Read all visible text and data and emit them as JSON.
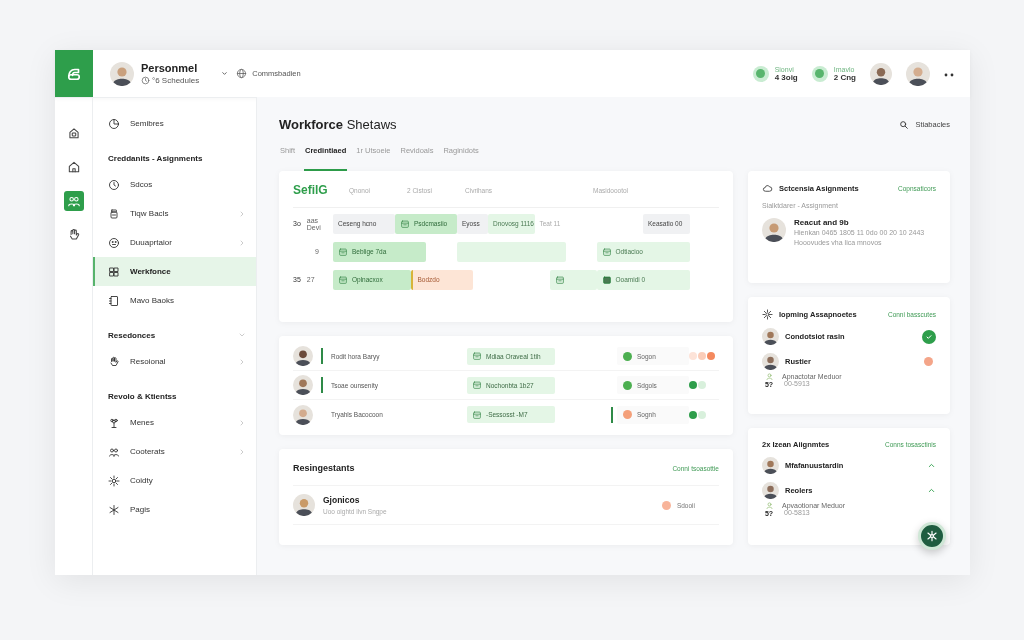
{
  "header": {
    "title": "Personmel",
    "subtitle": "°6 Schedules",
    "location": "Commsbadien",
    "stats": [
      {
        "label": "Sionvi",
        "value": "4 3oig"
      },
      {
        "label": "Imavlo",
        "value": "2 Cng"
      }
    ]
  },
  "rail": [
    {
      "selected": false
    },
    {
      "selected": false
    },
    {
      "selected": true
    },
    {
      "selected": false
    }
  ],
  "sidebar": {
    "items": [
      {
        "kind": "item",
        "label": "Semibres",
        "chevron": false,
        "selected": false
      },
      {
        "kind": "section",
        "label": "Creddanits - Asignments",
        "collapsible": false
      },
      {
        "kind": "item",
        "label": "Sdcos",
        "chevron": false,
        "selected": false
      },
      {
        "kind": "item",
        "label": "Tiqw Bacls",
        "chevron": true,
        "selected": false
      },
      {
        "kind": "item",
        "label": "Duuaprtaior",
        "chevron": true,
        "selected": false
      },
      {
        "kind": "item",
        "label": "Werkfonce",
        "chevron": false,
        "selected": true
      },
      {
        "kind": "item",
        "label": "Mavo Baoks",
        "chevron": false,
        "selected": false
      },
      {
        "kind": "section",
        "label": "Resedonces",
        "collapsible": true
      },
      {
        "kind": "item",
        "label": "Resoional",
        "chevron": true,
        "selected": false
      },
      {
        "kind": "section",
        "label": "Revolo & Ktientss",
        "collapsible": false
      },
      {
        "kind": "item",
        "label": "Menes",
        "chevron": true,
        "selected": false
      },
      {
        "kind": "item",
        "label": "Cooterats",
        "chevron": true,
        "selected": false
      },
      {
        "kind": "item",
        "label": "Coidty",
        "chevron": false,
        "selected": false
      },
      {
        "kind": "item",
        "label": "Pagis",
        "chevron": false,
        "selected": false
      }
    ]
  },
  "page": {
    "title": "**Workforce** Shetaws",
    "search": "Stiabacles",
    "tabs": [
      {
        "label": "Shift",
        "selected": false
      },
      {
        "label": "Credintiaed",
        "selected": true
      },
      {
        "label": "1r Utsoeie",
        "selected": false
      },
      {
        "label": "Revidoals",
        "selected": false
      },
      {
        "label": "Raginidots",
        "selected": false
      }
    ]
  },
  "schedule": {
    "title": "SefilG",
    "columns": [
      "Qnonoi",
      "2 Cistosi",
      "Civrihans",
      "Masidoootol"
    ],
    "rows": [
      {
        "label": "3o",
        "sublabel": "aas Devi",
        "cells": [
          {
            "kind": "plain",
            "text": "Ceseng hcno"
          },
          {
            "kind": "shift",
            "text": "Psdcmasiio"
          },
          {
            "kind": "plain",
            "text": "Eyoss"
          },
          {
            "kind": "note",
            "text": "Dnovosg 1116"
          },
          {
            "kind": "faint",
            "text": "Teat 11"
          },
          {
            "kind": "plain",
            "text": "Keasatio 00"
          }
        ]
      },
      {
        "sublabel": "9",
        "cells": [
          {
            "kind": "shift",
            "text": "Beblige 7da"
          },
          {
            "kind": "blank"
          },
          {
            "kind": "event",
            "text": "Odtiacioo"
          }
        ]
      },
      {
        "label": "35",
        "sublabel": "27",
        "cells": [
          {
            "kind": "shift",
            "text": "Oplnacxox"
          },
          {
            "kind": "alert",
            "text": "Bodzdo"
          },
          {
            "kind": "event"
          },
          {
            "kind": "done",
            "text": "Ooamidi 0"
          }
        ]
      }
    ]
  },
  "staff": [
    {
      "name": "Rodit hora Baryy",
      "kind": "leading",
      "shift": "Mdiaa Oraveal 1tih",
      "status": "Sogon",
      "color": "#4caf50",
      "indicators": [
        {
          "color": "#fde3d8"
        },
        {
          "color": "#fbcdb9"
        },
        {
          "color": "#f4895e"
        }
      ]
    },
    {
      "name": "Tsoae ounsenity",
      "kind": "leading",
      "shift": "Nochonbta 1b27",
      "status": "Sdgols",
      "color": "#4caf50",
      "indicators": [
        {
          "color": "#2e9e4b"
        },
        {
          "color": "#d8f0dc"
        }
      ]
    },
    {
      "name": "Tryahls Bacocoon",
      "kind": "trailing",
      "shift": "-Sessosst -M7",
      "status": "Sognh",
      "color": "#f4a07a",
      "indicators": [
        {
          "color": "#2e9e4b"
        },
        {
          "color": "#d8f0dc"
        }
      ]
    }
  ],
  "resignations": {
    "title": "Resingestants",
    "link": "Conni tsoasottie",
    "people": [
      {
        "name": "Gjonicos",
        "detail": "Uoo oightd ilvn Sngpe",
        "status": "Sdooii",
        "color": "#f8b49a"
      }
    ]
  },
  "cards": [
    {
      "title": "Sctcensia Asignments",
      "link": "Copnsaticors",
      "subtitle": "Sialktdarer - Assignment",
      "people": [
        {
          "kind": "profile",
          "name": "Reacut and 9b",
          "lines": [
            "Hienkan 0465 1805 11 0do 00 20 10 2443",
            "Hooovudes vha lica mnovos"
          ]
        }
      ]
    },
    {
      "title": "Iopming Assapnoetes",
      "link": "Conni basscutes",
      "people": [
        {
          "kind": "check",
          "name": "Condotsiot rasin"
        },
        {
          "kind": "dot",
          "name": "Rustier",
          "detail": "Apnactotar Meduor",
          "badge": "5?",
          "code": "00-5913"
        }
      ]
    },
    {
      "title": "2x Izean Aiignmtes",
      "link": "Conns tosasctinis",
      "people": [
        {
          "kind": "expand",
          "name": "Mfafanuustardin",
          "expanded": true
        },
        {
          "kind": "expand",
          "name": "Reolers",
          "expanded": true,
          "detail": "Apvaotionar Meduor",
          "badge": "5?",
          "code": "00-5813"
        }
      ]
    }
  ]
}
